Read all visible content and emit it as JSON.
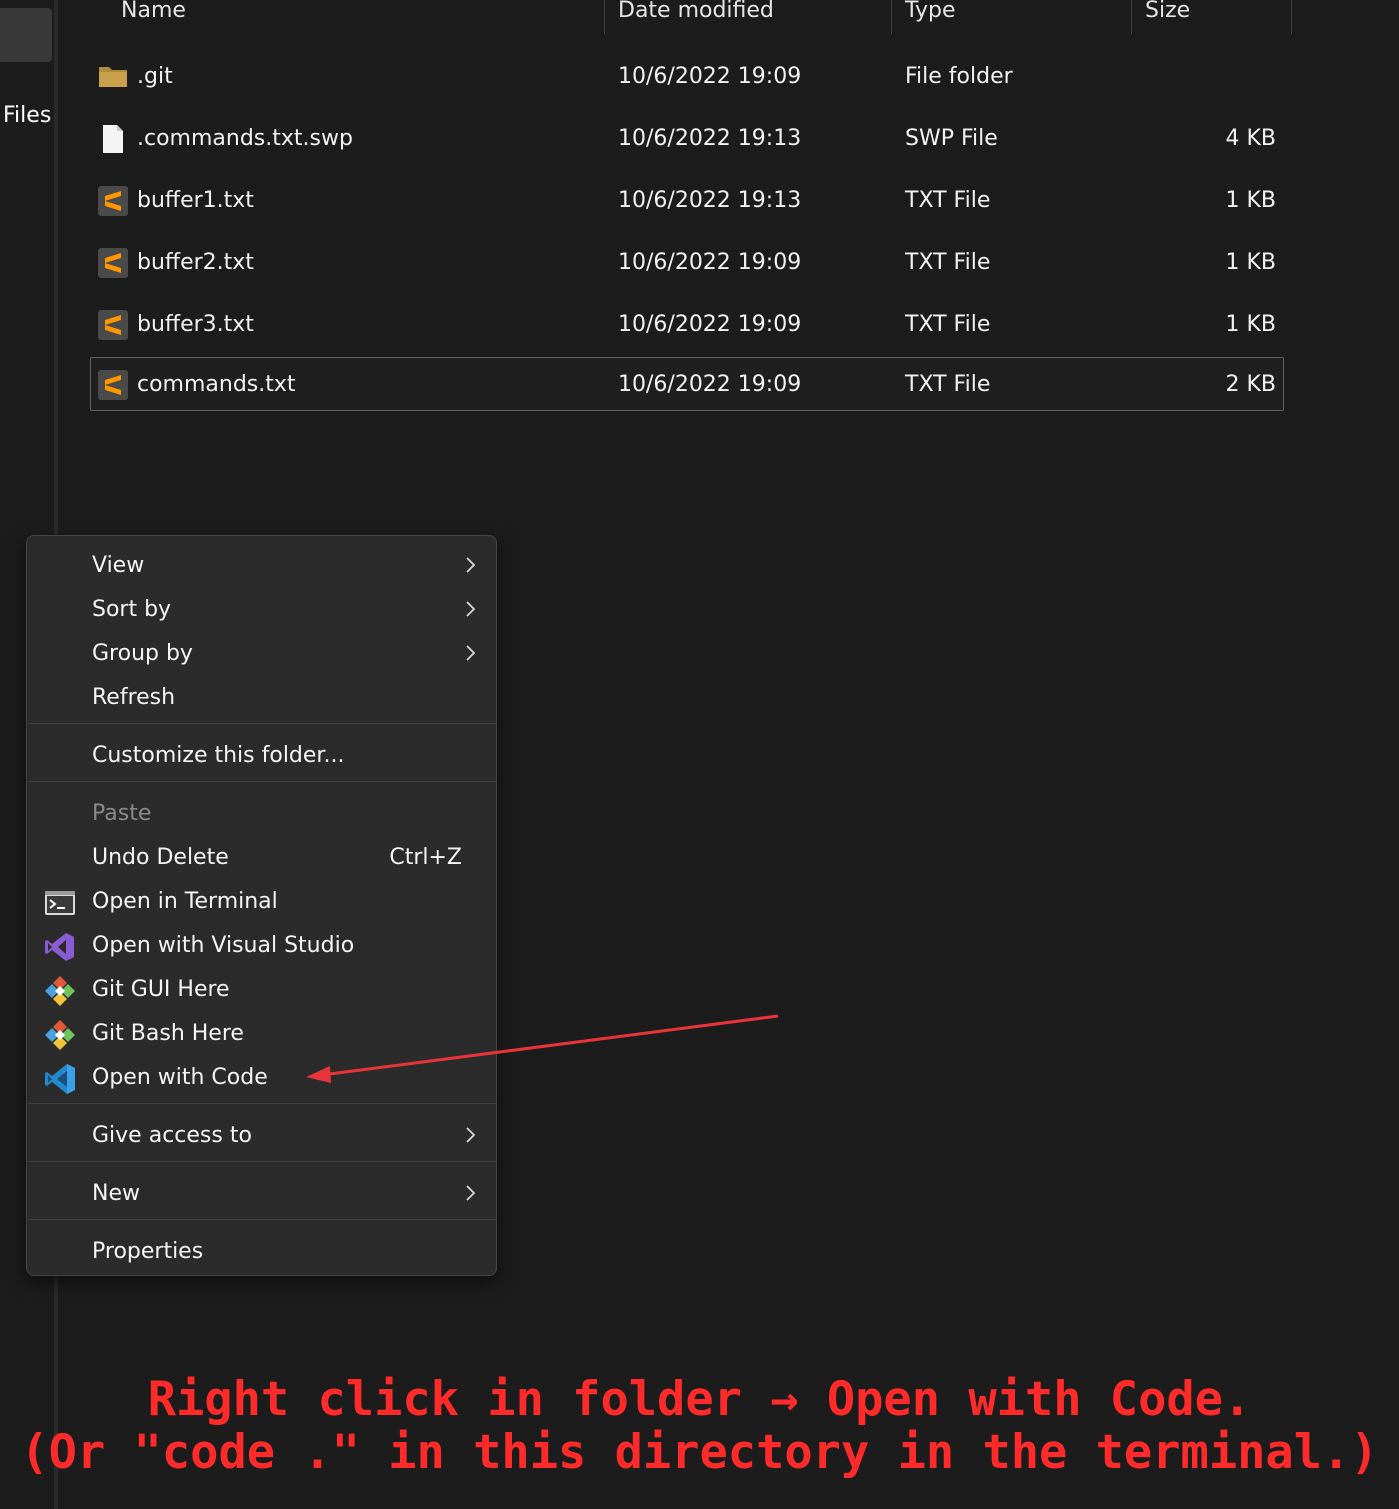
{
  "sidebar": {
    "label": "Files"
  },
  "columns": {
    "name": "Name",
    "date_modified": "Date modified",
    "type": "Type",
    "size": "Size"
  },
  "files": [
    {
      "name": ".git",
      "date": "10/6/2022 19:09",
      "type": "File folder",
      "size": "",
      "icon": "folder-icon"
    },
    {
      "name": ".commands.txt.swp",
      "date": "10/6/2022 19:13",
      "type": "SWP File",
      "size": "4 KB",
      "icon": "blank-file-icon"
    },
    {
      "name": "buffer1.txt",
      "date": "10/6/2022 19:13",
      "type": "TXT File",
      "size": "1 KB",
      "icon": "sublime-text-icon"
    },
    {
      "name": "buffer2.txt",
      "date": "10/6/2022 19:09",
      "type": "TXT File",
      "size": "1 KB",
      "icon": "sublime-text-icon"
    },
    {
      "name": "buffer3.txt",
      "date": "10/6/2022 19:09",
      "type": "TXT File",
      "size": "1 KB",
      "icon": "sublime-text-icon"
    },
    {
      "name": "commands.txt",
      "date": "10/6/2022 19:09",
      "type": "TXT File",
      "size": "2 KB",
      "icon": "sublime-text-icon",
      "selected": true
    }
  ],
  "context_menu": {
    "view": "View",
    "sort_by": "Sort by",
    "group_by": "Group by",
    "refresh": "Refresh",
    "customize": "Customize this folder...",
    "paste": "Paste",
    "undo_delete": "Undo Delete",
    "undo_shortcut": "Ctrl+Z",
    "open_terminal": "Open in Terminal",
    "open_visual_studio": "Open with Visual Studio",
    "git_gui": "Git GUI Here",
    "git_bash": "Git Bash Here",
    "open_code": "Open with Code",
    "give_access": "Give access to",
    "new": "New",
    "properties": "Properties"
  },
  "annotation": {
    "line1": "Right click in folder → Open with Code.",
    "line2": "(Or \"code .\" in this directory in the terminal.)",
    "color": "#ff2b2b"
  },
  "colors": {
    "background": "#1c1c1c",
    "menu_background": "#2b2b2b",
    "sublime_orange": "#ff9800",
    "folder_gold": "#c8a14a",
    "vs_purple": "#8a5cd1",
    "vscode_blue": "#2489ca"
  }
}
